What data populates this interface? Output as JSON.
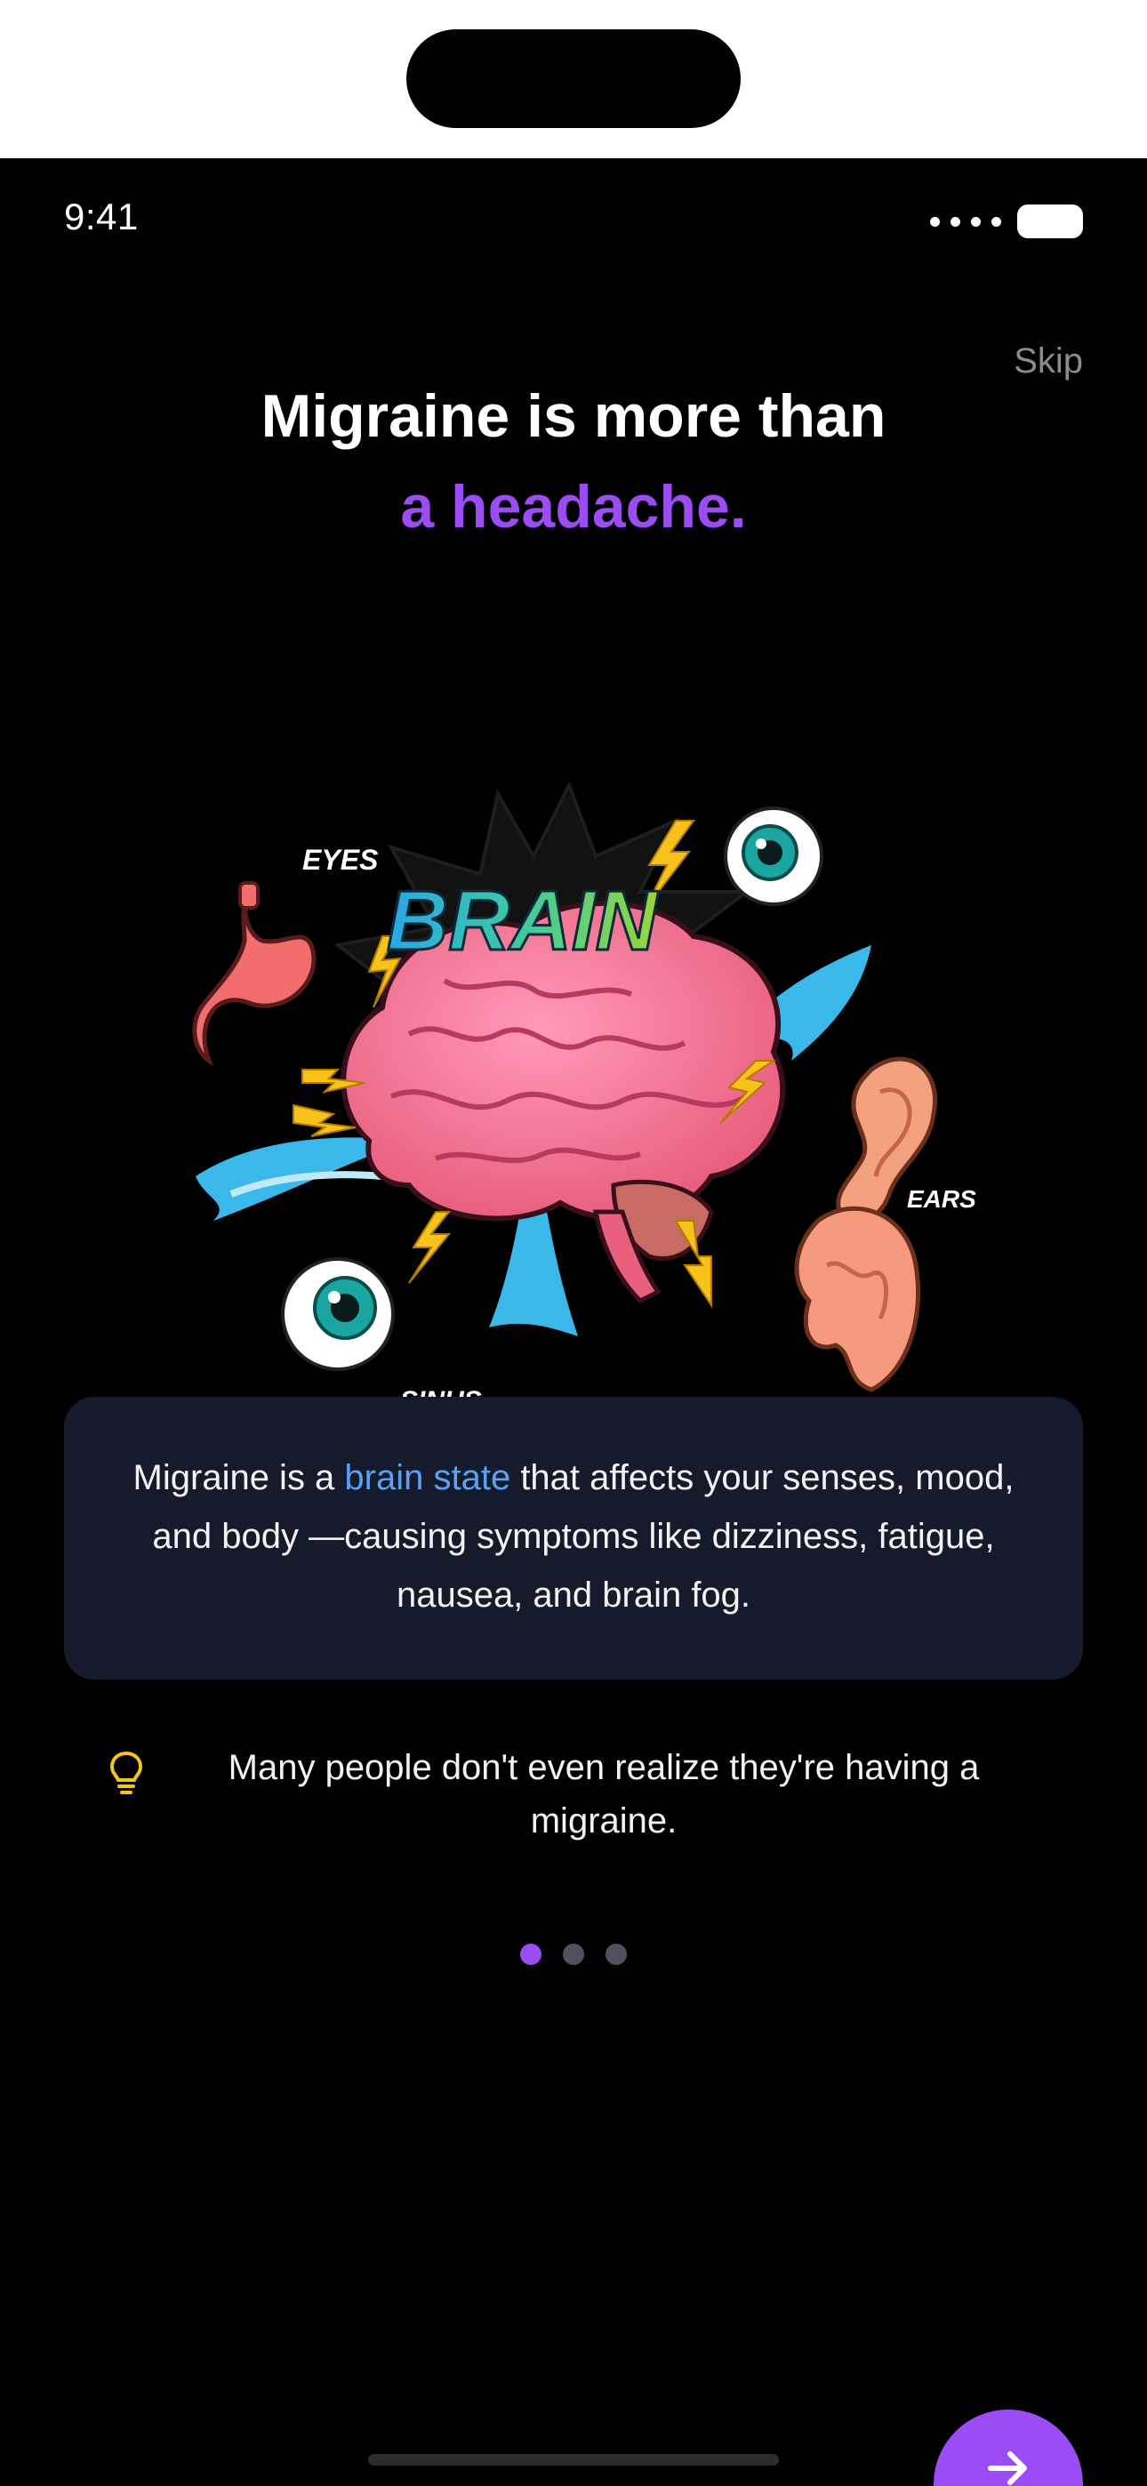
{
  "status_bar": {
    "time": "9:41"
  },
  "skip_label": "Skip",
  "heading": {
    "line1": "Migraine is more than",
    "line2": "a headache."
  },
  "illustration": {
    "labels": {
      "brain": "BRAIN",
      "eyes": "EYES",
      "ears": "EARS",
      "sinus": "SINUS"
    }
  },
  "info_card": {
    "prefix": "Migraine is a ",
    "highlight": "brain state",
    "suffix": " that affects your senses, mood, and body —causing symptoms like dizziness, fatigue, nausea, and brain fog."
  },
  "tip": {
    "icon": "lightbulb-icon",
    "text": "Many people don't even realize they're having a migraine."
  },
  "pager": {
    "total": 3,
    "active_index": 0
  },
  "next_button": {
    "icon": "arrow-right-icon"
  },
  "colors": {
    "accent": "#9b4cf5",
    "highlight": "#5aa0f5",
    "card": "#161b2b",
    "bulb": "#f5c518"
  }
}
